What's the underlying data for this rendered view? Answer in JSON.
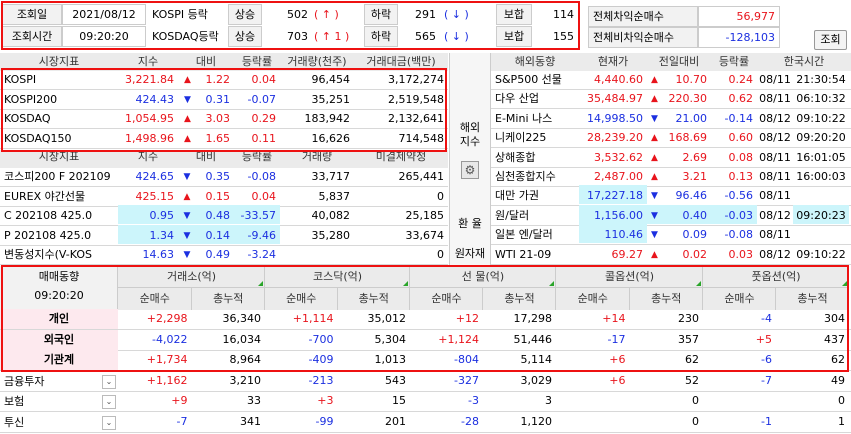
{
  "top": {
    "r1": {
      "l1": "조회일",
      "date": "2021/08/12",
      "mk": "KOSPI 등락",
      "up": "상승",
      "upn": "502",
      "upm": "(  ↑  )",
      "dn": "하락",
      "dnn": "291",
      "dnm": "(  ↓  )",
      "fl": "보합",
      "fln": "114"
    },
    "r2": {
      "l1": "조회시간",
      "time": "09:20:20",
      "mk": "KOSDAQ등락",
      "up": "상승",
      "upn": "703",
      "upm": "(  ↑    1 )",
      "dn": "하락",
      "dnn": "565",
      "dnm": "(  ↓  )",
      "fl": "보합",
      "fln": "155"
    },
    "pg1": {
      "label": "전체차익순매수",
      "value": "56,977"
    },
    "pg2": {
      "label": "전체비차익순매수",
      "value": "-128,103"
    },
    "query_btn": "조회"
  },
  "mkt": {
    "headers": [
      "시장지표",
      "지수",
      "대비",
      "등락률",
      "거래량(천주)",
      "거래대금(백만)"
    ],
    "headers2": [
      "시장지표",
      "지수",
      "대비",
      "등락률",
      "거래량",
      "미결제약정"
    ],
    "rows": [
      {
        "name": "KOSPI",
        "idx": "3,221.84",
        "arrow": "▲",
        "chg": "1.22",
        "rate": "0.04",
        "vol": "96,454",
        "amt": "3,172,274",
        "d": "up"
      },
      {
        "name": "KOSPI200",
        "idx": "424.43",
        "arrow": "▼",
        "chg": "0.31",
        "rate": "-0.07",
        "vol": "35,251",
        "amt": "2,519,548",
        "d": "dn"
      },
      {
        "name": "KOSDAQ",
        "idx": "1,054.95",
        "arrow": "▲",
        "chg": "3.03",
        "rate": "0.29",
        "vol": "183,942",
        "amt": "2,132,641",
        "d": "up"
      },
      {
        "name": "KOSDAQ150",
        "idx": "1,498.96",
        "arrow": "▲",
        "chg": "1.65",
        "rate": "0.11",
        "vol": "16,626",
        "amt": "714,548",
        "d": "up"
      }
    ],
    "rows2": [
      {
        "name": "코스피200 F 202109",
        "idx": "424.65",
        "arrow": "▼",
        "chg": "0.35",
        "rate": "-0.08",
        "vol": "33,717",
        "oi": "265,441",
        "d": "dn"
      },
      {
        "name": "EUREX 야간선물",
        "idx": "425.15",
        "arrow": "▲",
        "chg": "0.15",
        "rate": "0.04",
        "vol": "5,837",
        "oi": "0",
        "d": "up"
      },
      {
        "name": "C 202108 425.0",
        "idx": "0.95",
        "arrow": "▼",
        "chg": "0.48",
        "rate": "-33.57",
        "vol": "40,082",
        "oi": "25,185",
        "d": "dn"
      },
      {
        "name": "P 202108 425.0",
        "idx": "1.34",
        "arrow": "▼",
        "chg": "0.14",
        "rate": "-9.46",
        "vol": "35,280",
        "oi": "33,674",
        "d": "dn"
      },
      {
        "name": "변동성지수(V-KOS",
        "idx": "14.63",
        "arrow": "▼",
        "chg": "0.49",
        "rate": "-3.24",
        "vol": "",
        "oi": "0",
        "d": "dn"
      }
    ]
  },
  "side": {
    "btn1": "해외\n지수",
    "btn2": "환 율",
    "btn3": "원자재"
  },
  "world": {
    "headers": [
      "해외동향",
      "현재가",
      "전일대비",
      "등락률",
      "한국시간"
    ],
    "rows": [
      {
        "name": "S&P500 선물",
        "price": "4,440.60",
        "arrow": "▲",
        "chg": "10.70",
        "rate": "0.24",
        "date": "08/11",
        "time": "21:30:54",
        "d": "up"
      },
      {
        "name": "다우 산업",
        "price": "35,484.97",
        "arrow": "▲",
        "chg": "220.30",
        "rate": "0.62",
        "date": "08/11",
        "time": "06:10:32",
        "d": "up"
      },
      {
        "name": "E-Mini 나스",
        "price": "14,998.50",
        "arrow": "▼",
        "chg": "21.00",
        "rate": "-0.14",
        "date": "08/12",
        "time": "09:10:22",
        "d": "dn"
      },
      {
        "name": "니케이225",
        "price": "28,239.20",
        "arrow": "▲",
        "chg": "168.69",
        "rate": "0.60",
        "date": "08/12",
        "time": "09:20:20",
        "d": "up"
      },
      {
        "name": "상해종합",
        "price": "3,532.62",
        "arrow": "▲",
        "chg": "2.69",
        "rate": "0.08",
        "date": "08/11",
        "time": "16:01:05",
        "d": "up"
      },
      {
        "name": "심천종합지수",
        "price": "2,487.00",
        "arrow": "▲",
        "chg": "3.21",
        "rate": "0.13",
        "date": "08/11",
        "time": "16:00:03",
        "d": "up"
      },
      {
        "name": "대만 가권",
        "price": "17,227.18",
        "arrow": "▼",
        "chg": "96.46",
        "rate": "-0.56",
        "date": "08/11",
        "time": "",
        "d": "dn"
      },
      {
        "name": "원/달러",
        "price": "1,156.00",
        "arrow": "▼",
        "chg": "0.40",
        "rate": "-0.03",
        "date": "08/12",
        "time": "09:20:23",
        "d": "dn"
      },
      {
        "name": "일본 엔/달러",
        "price": "110.46",
        "arrow": "▼",
        "chg": "0.09",
        "rate": "-0.08",
        "date": "08/11",
        "time": "",
        "d": "dn"
      },
      {
        "name": "WTI 21-09",
        "price": "69.27",
        "arrow": "▲",
        "chg": "0.02",
        "rate": "0.03",
        "date": "08/12",
        "time": "09:10:22",
        "d": "up"
      }
    ]
  },
  "inv": {
    "title": "매매동향",
    "time": "09:20:20",
    "groups": [
      "거래소(억)",
      "코스닥(억)",
      "선  물(억)",
      "콜옵션(억)",
      "풋옵션(억)"
    ],
    "sub": [
      "순매수",
      "총누적"
    ],
    "rows": [
      {
        "name": "개인",
        "v": [
          "+2,298",
          "36,340",
          "+1,114",
          "35,012",
          "+12",
          "17,298",
          "+14",
          "230",
          "-4",
          "304"
        ]
      },
      {
        "name": "외국인",
        "v": [
          "-4,022",
          "16,034",
          "-700",
          "5,304",
          "+1,124",
          "51,446",
          "-17",
          "357",
          "+5",
          "437"
        ]
      },
      {
        "name": "기관계",
        "v": [
          "+1,734",
          "8,964",
          "-409",
          "1,013",
          "-804",
          "5,114",
          "+6",
          "62",
          "-6",
          "62"
        ]
      }
    ],
    "rows2": [
      {
        "name": "금융투자",
        "v": [
          "+1,162",
          "3,210",
          "-213",
          "543",
          "-327",
          "3,029",
          "+6",
          "52",
          "-7",
          "49"
        ]
      },
      {
        "name": "보험",
        "v": [
          "+9",
          "33",
          "+3",
          "15",
          "-3",
          "3",
          "",
          "0",
          "",
          "0"
        ]
      },
      {
        "name": "투신",
        "v": [
          "-7",
          "341",
          "-99",
          "201",
          "-28",
          "1,120",
          "",
          "0",
          "-1",
          "1"
        ]
      }
    ]
  },
  "colors": {
    "up": "#e8141c",
    "down": "#1b2fe0",
    "highlight": "#e11111",
    "cyan": "#ccf5fb"
  }
}
